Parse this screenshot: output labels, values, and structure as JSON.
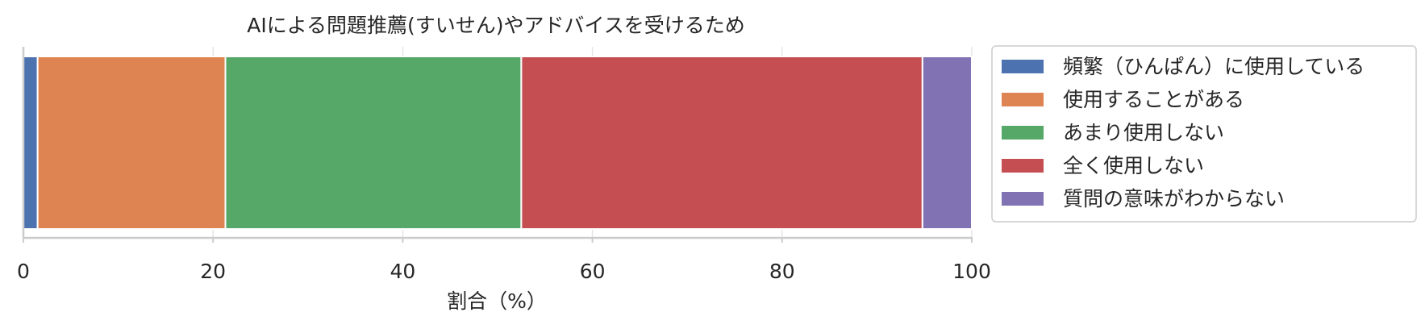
{
  "chart_data": {
    "type": "bar",
    "orientation": "horizontal-stacked",
    "title": "AIによる問題推薦(すいせん)やアドバイスを受けるため",
    "xlabel": "割合（%）",
    "ylabel": "",
    "xlim": [
      0,
      100
    ],
    "xticks": [
      "0",
      "20",
      "40",
      "60",
      "80",
      "100"
    ],
    "grid": "vertical",
    "legend_position": "right",
    "series": [
      {
        "name": "頻繁（ひんぱん）に使用している",
        "value": 1.5,
        "color": "#4C72B0"
      },
      {
        "name": "使用することがある",
        "value": 19.8,
        "color": "#DD8452"
      },
      {
        "name": "あまり使用しない",
        "value": 31.2,
        "color": "#55A868"
      },
      {
        "name": "全く使用しない",
        "value": 42.3,
        "color": "#C44E52"
      },
      {
        "name": "質問の意味がわからない",
        "value": 5.2,
        "color": "#8172B3"
      }
    ]
  }
}
